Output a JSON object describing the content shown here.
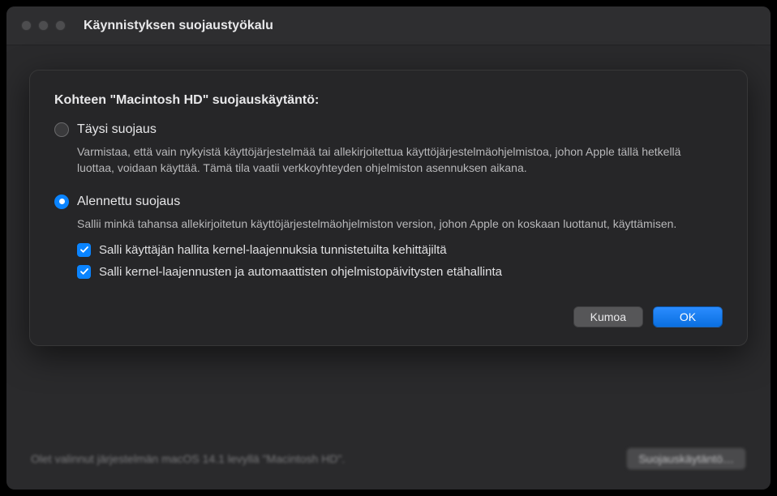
{
  "window": {
    "title": "Käynnistyksen suojaustyökalu"
  },
  "background": {
    "status_text": "Olet valinnut järjestelmän macOS 14.1 levyllä \"Macintosh HD\".",
    "policy_button": "Suojauskäytäntö…"
  },
  "sheet": {
    "title": "Kohteen \"Macintosh HD\" suojauskäytäntö:",
    "options": {
      "full": {
        "label": "Täysi suojaus",
        "desc": "Varmistaa, että vain nykyistä käyttöjärjestelmää tai allekirjoitettua käyttöjärjestelmäohjelmistoa, johon Apple tällä hetkellä luottaa, voidaan käyttää. Tämä tila vaatii verkkoyhteyden ohjelmiston asennuksen aikana."
      },
      "reduced": {
        "label": "Alennettu suojaus",
        "desc": "Sallii minkä tahansa allekirjoitetun käyttöjärjestelmäohjelmiston version, johon Apple on koskaan luottanut, käyttämisen.",
        "checkboxes": {
          "kext": "Salli käyttäjän hallita kernel-laajennuksia tunnistetuilta kehittäjiltä",
          "remote": "Salli kernel-laajennusten ja automaattisten ohjelmistopäivitysten etähallinta"
        }
      }
    },
    "buttons": {
      "cancel": "Kumoa",
      "ok": "OK"
    }
  }
}
